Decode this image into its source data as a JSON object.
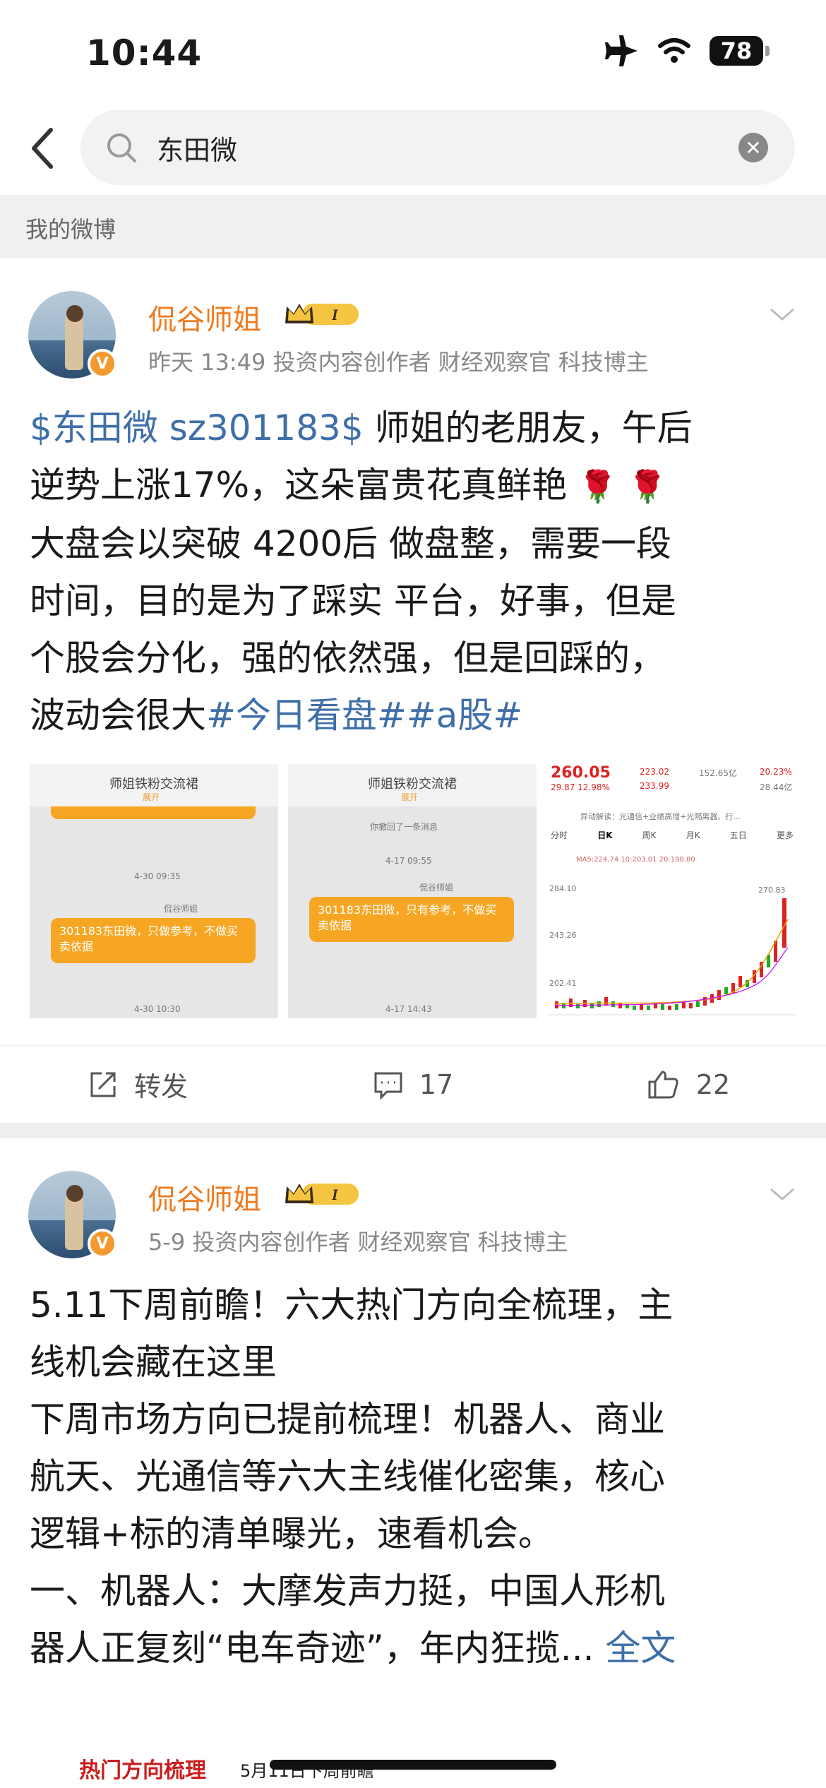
{
  "status_bar": {
    "time": "10:44",
    "battery": "78"
  },
  "search": {
    "query": "东田微"
  },
  "section_header": "我的微博",
  "posts": [
    {
      "author": "侃谷师姐",
      "level_badge": "I",
      "time": "昨天 13:49",
      "tags": "投资内容创作者 财经观察官 科技博主",
      "stock_tag": "$东田微 sz301183$",
      "line1_rest": " 师姐的老朋友，午后",
      "line2": "逆势上涨17%，这朵富贵花真鲜艳",
      "line3": "大盘会以突破 4200后  做盘整，需要一段",
      "line4": "时间，目的是为了踩实 平台，好事，但是",
      "line5": "个股会分化，强的依然强，但是回踩的，",
      "line6_plain": "波动会很大",
      "hashtags": "#今日看盘##a股#",
      "images": [
        {
          "title": "师姐铁粉交流裙",
          "sub": "展开",
          "timestamp": "4-30 09:35",
          "sender": "侃谷师姐",
          "message": "301183东田微，只做参考，不做买卖依据",
          "timestamp2": "4-30 10:30"
        },
        {
          "title": "师姐铁粉交流裙",
          "sub": "展开",
          "recall": "你撤回了一条消息",
          "timestamp": "4-17 09:55",
          "sender": "侃谷师姐",
          "message": "301183东田微，只有参考，不做买卖依据",
          "timestamp2": "4-17 14:43"
        },
        {
          "price": "260.05",
          "change": "29.87  12.98%",
          "high": "223.02",
          "low": "233.99",
          "circ": "152.65亿",
          "ratio": "20.23%",
          "mcap": "28.44亿",
          "banner": "异动解读：光通信+业绩高增+光隔离器、行...",
          "tabs": [
            "分时",
            "日K",
            "周K",
            "月K",
            "五日",
            "更多"
          ],
          "ma": "MA5:224.74  10:203.01  20:198.80",
          "ticks": [
            "284.10",
            "243.26",
            "202.41"
          ],
          "peak": "270.83"
        }
      ],
      "repost_label": "转发",
      "comments": "17",
      "likes": "22"
    },
    {
      "author": "侃谷师姐",
      "level_badge": "I",
      "time": "5-9",
      "tags": "投资内容创作者 财经观察官 科技博主",
      "lines": [
        "5.11下周前瞻！六大热门方向全梳理，主",
        "线机会藏在这里",
        "下周市场方向已提前梳理！机器人、商业",
        "航天、光通信等六大主线催化密集，核心",
        "逻辑+标的清单曝光，速看机会。",
        "一、机器人：大摩发声力挺，中国人形机"
      ],
      "last_line": "器人正复刻“电车奇迹”，年内狂揽...",
      "full_text": "全文",
      "preview_title": "热门方向梳理",
      "preview_date": "5月11日下周前瞻"
    }
  ],
  "colors": {
    "accent_orange": "#f07a1c",
    "link_blue": "#3f6fa8",
    "rise_red": "#d22"
  }
}
